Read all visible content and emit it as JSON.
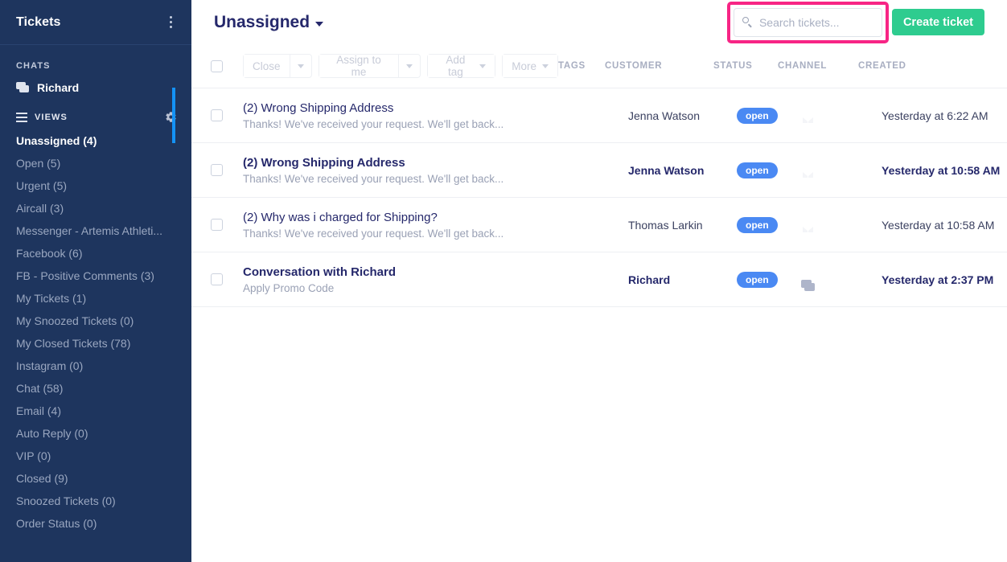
{
  "sidebar": {
    "title": "Tickets",
    "kebab_icon": "more-vertical-icon",
    "chats_label": "CHATS",
    "chats": [
      {
        "label": "Richard",
        "icon": "chat-icon"
      }
    ],
    "views_label": "VIEWS",
    "views_icon": "list-icon",
    "views_settings_icon": "gear-icon",
    "views": [
      {
        "label": "Unassigned (4)",
        "active": true
      },
      {
        "label": "Open (5)",
        "active": false
      },
      {
        "label": "Urgent (5)",
        "active": false
      },
      {
        "label": "Aircall (3)",
        "active": false
      },
      {
        "label": "Messenger - Artemis Athleti...",
        "active": false
      },
      {
        "label": "Facebook (6)",
        "active": false
      },
      {
        "label": "FB - Positive Comments (3)",
        "active": false
      },
      {
        "label": "My Tickets (1)",
        "active": false
      },
      {
        "label": "My Snoozed Tickets (0)",
        "active": false
      },
      {
        "label": "My Closed Tickets (78)",
        "active": false
      },
      {
        "label": "Instagram (0)",
        "active": false
      },
      {
        "label": "Chat (58)",
        "active": false
      },
      {
        "label": "Email (4)",
        "active": false
      },
      {
        "label": "Auto Reply (0)",
        "active": false
      },
      {
        "label": "VIP (0)",
        "active": false
      },
      {
        "label": "Closed (9)",
        "active": false
      },
      {
        "label": "Snoozed Tickets (0)",
        "active": false
      },
      {
        "label": "Order Status (0)",
        "active": false
      }
    ]
  },
  "header": {
    "view_title": "Unassigned",
    "view_caret_icon": "chevron-down-icon",
    "search": {
      "icon": "search-icon",
      "value": "",
      "placeholder": "Search tickets...",
      "highlight_color": "#f72585"
    },
    "create_button": "Create ticket",
    "create_button_color": "#2ecc8f"
  },
  "toolbar": {
    "select_all_checkbox": "",
    "close_label": "Close",
    "close_caret_icon": "caret-down-icon",
    "assign_label": "Assign to me",
    "assign_caret_icon": "caret-down-icon",
    "addtag_label": "Add tag",
    "addtag_caret_icon": "caret-down-icon",
    "more_label": "More",
    "more_caret_icon": "caret-down-icon"
  },
  "columns": {
    "tags": "TAGS",
    "customer": "CUSTOMER",
    "status": "STATUS",
    "channel": "CHANNEL",
    "created": "CREATED"
  },
  "tickets": [
    {
      "subject": "(2) Wrong Shipping Address",
      "preview": "Thanks! We've received your request. We'll get back...",
      "customer": "Jenna Watson",
      "status": "open",
      "channel_icon": "mail-icon",
      "created": "Yesterday at 6:22 AM",
      "unread": false,
      "selected": true
    },
    {
      "subject": "(2) Wrong Shipping Address",
      "preview": "Thanks! We've received your request. We'll get back...",
      "customer": "Jenna Watson",
      "status": "open",
      "channel_icon": "mail-icon",
      "created": "Yesterday at 10:58 AM",
      "unread": true,
      "selected": false
    },
    {
      "subject": "(2) Why was i charged for Shipping?",
      "preview": "Thanks! We've received your request. We'll get back...",
      "customer": "Thomas Larkin",
      "status": "open",
      "channel_icon": "mail-icon",
      "created": "Yesterday at 10:58 AM",
      "unread": false,
      "selected": false
    },
    {
      "subject": "Conversation with Richard",
      "preview": "Apply Promo Code",
      "customer": "Richard",
      "status": "open",
      "channel_icon": "chat-icon",
      "created": "Yesterday at 2:37 PM",
      "unread": true,
      "selected": false
    }
  ]
}
